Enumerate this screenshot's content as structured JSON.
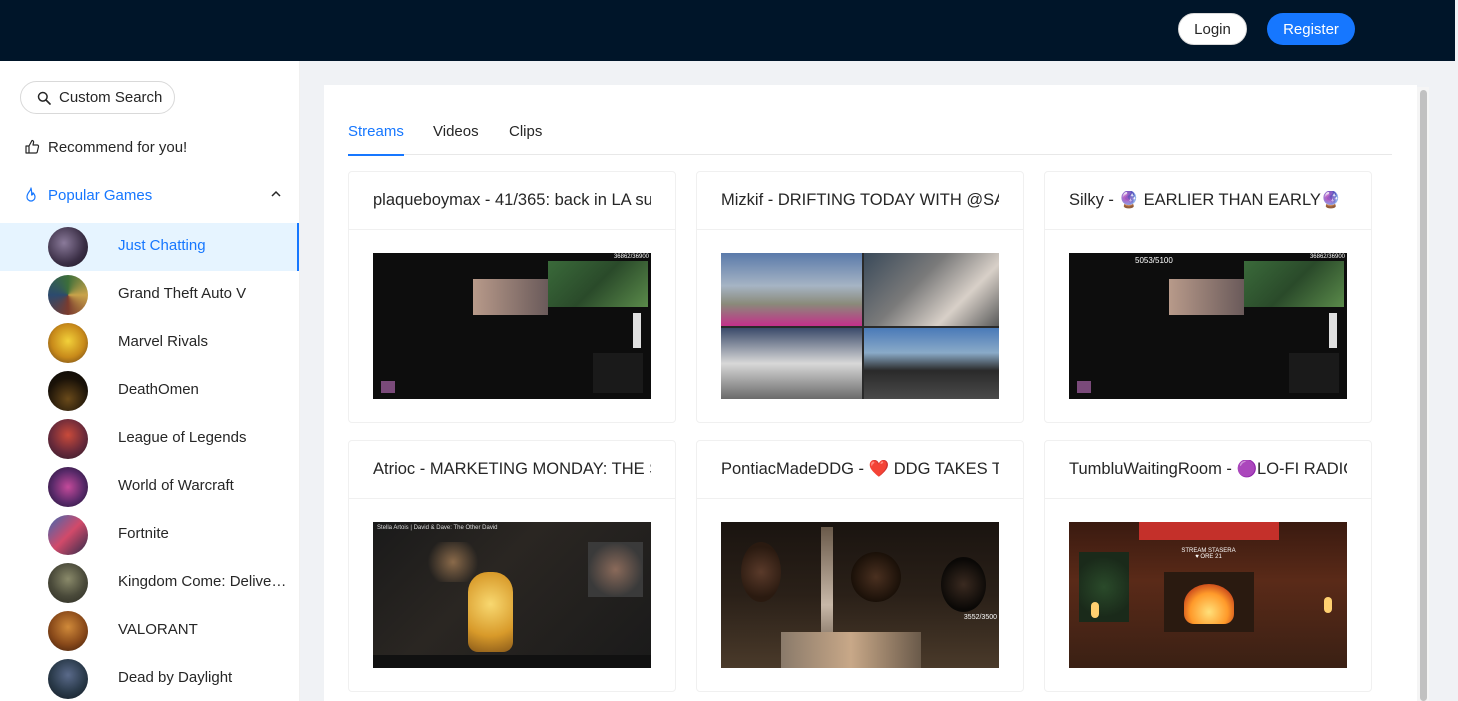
{
  "header": {
    "login_label": "Login",
    "register_label": "Register"
  },
  "sidebar": {
    "search_label": "Custom Search",
    "recommend_label": "Recommend for you!",
    "popular_label": "Popular Games",
    "games": [
      {
        "name": "Just Chatting",
        "selected": true
      },
      {
        "name": "Grand Theft Auto V"
      },
      {
        "name": "Marvel Rivals"
      },
      {
        "name": "DeathOmen"
      },
      {
        "name": "League of Legends"
      },
      {
        "name": "World of Warcraft"
      },
      {
        "name": "Fortnite"
      },
      {
        "name": "Kingdom Come: Deliver..."
      },
      {
        "name": "VALORANT"
      },
      {
        "name": "Dead by Daylight"
      }
    ]
  },
  "tabs": [
    "Streams",
    "Videos",
    "Clips"
  ],
  "streams": [
    {
      "title": "plaqueboymax - 41/365: back in LA su",
      "overlay": "36862/36900"
    },
    {
      "title": "Mizkif - DRIFTING TODAY WITH @SAM"
    },
    {
      "title": "Silky - 🔮 EARLIER THAN EARLY🔮 DO",
      "overlay": "5053/5100",
      "overlay2": "36862/36900"
    },
    {
      "title": "Atrioc - MARKETING MONDAY: THE S",
      "overlay": "Stella Artois | David & Dave: The Other David"
    },
    {
      "title": "PontiacMadeDDG - ❤️ DDG TAKES TE",
      "overlay": "3552/3500"
    },
    {
      "title": "TumbluWaitingRoom - 🟣LO-FI RADIO",
      "overlay": "STREAM STASERA ♥ ORE 21"
    }
  ],
  "colors": {
    "header": "#001529",
    "accent": "#1677ff"
  }
}
